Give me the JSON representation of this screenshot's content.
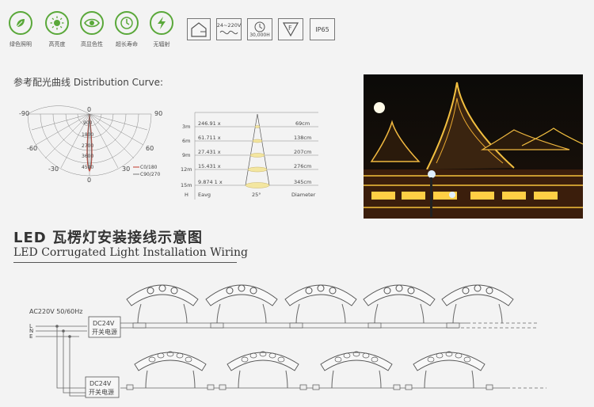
{
  "features": [
    {
      "icon": "leaf-icon",
      "label": "绿色照明"
    },
    {
      "icon": "sun-icon",
      "label": "高亮度"
    },
    {
      "icon": "eye-icon",
      "label": "高显色性"
    },
    {
      "icon": "clock-icon",
      "label": "超长寿命"
    },
    {
      "icon": "lightning-icon",
      "label": "无辐射"
    }
  ],
  "specs": {
    "voltage": "24~220V",
    "lifetime": "30,000H",
    "protection": "IP65"
  },
  "distribution": {
    "title": "参考配光曲线 Distribution Curve:",
    "polar": {
      "angles_top": [
        "-90",
        "90"
      ],
      "angles_mid": [
        "-60",
        "60"
      ],
      "angles_low": [
        "-30",
        "30"
      ],
      "center_zero": "0",
      "top_zero": "0",
      "rings": [
        "900",
        "1800",
        "2700",
        "3600",
        "4500"
      ],
      "legend": [
        "C0/180",
        "C90/270"
      ]
    },
    "beam": {
      "rows": [
        {
          "h": "3m",
          "eavg": "246.91 x",
          "diameter": "69cm"
        },
        {
          "h": "6m",
          "eavg": "61.711 x",
          "diameter": "138cm"
        },
        {
          "h": "9m",
          "eavg": "27.431 x",
          "diameter": "207cm"
        },
        {
          "h": "12m",
          "eavg": "15.431 x",
          "diameter": "276cm"
        },
        {
          "h": "15m",
          "eavg": "9.874 1 x",
          "diameter": "345cm"
        }
      ],
      "footer_h": "H",
      "footer_eavg": "Eavg",
      "footer_angle": "25°",
      "footer_diameter": "Diameter"
    }
  },
  "wiring": {
    "title_cn": "LED 瓦楞灯安装接线示意图",
    "title_en": "LED Corrugated Light Installation Wiring",
    "ac_label": "AC220V 50/60Hz",
    "lines": [
      "L",
      "N",
      "E"
    ],
    "driver1": {
      "line1": "DC24V",
      "line2": "开关电源"
    },
    "driver2": {
      "line1": "DC24V",
      "line2": "开关电源"
    }
  },
  "colors": {
    "accent_green": "#5aa83a",
    "line_gray": "#666666",
    "beam_yellow": "#f3e6a0"
  }
}
